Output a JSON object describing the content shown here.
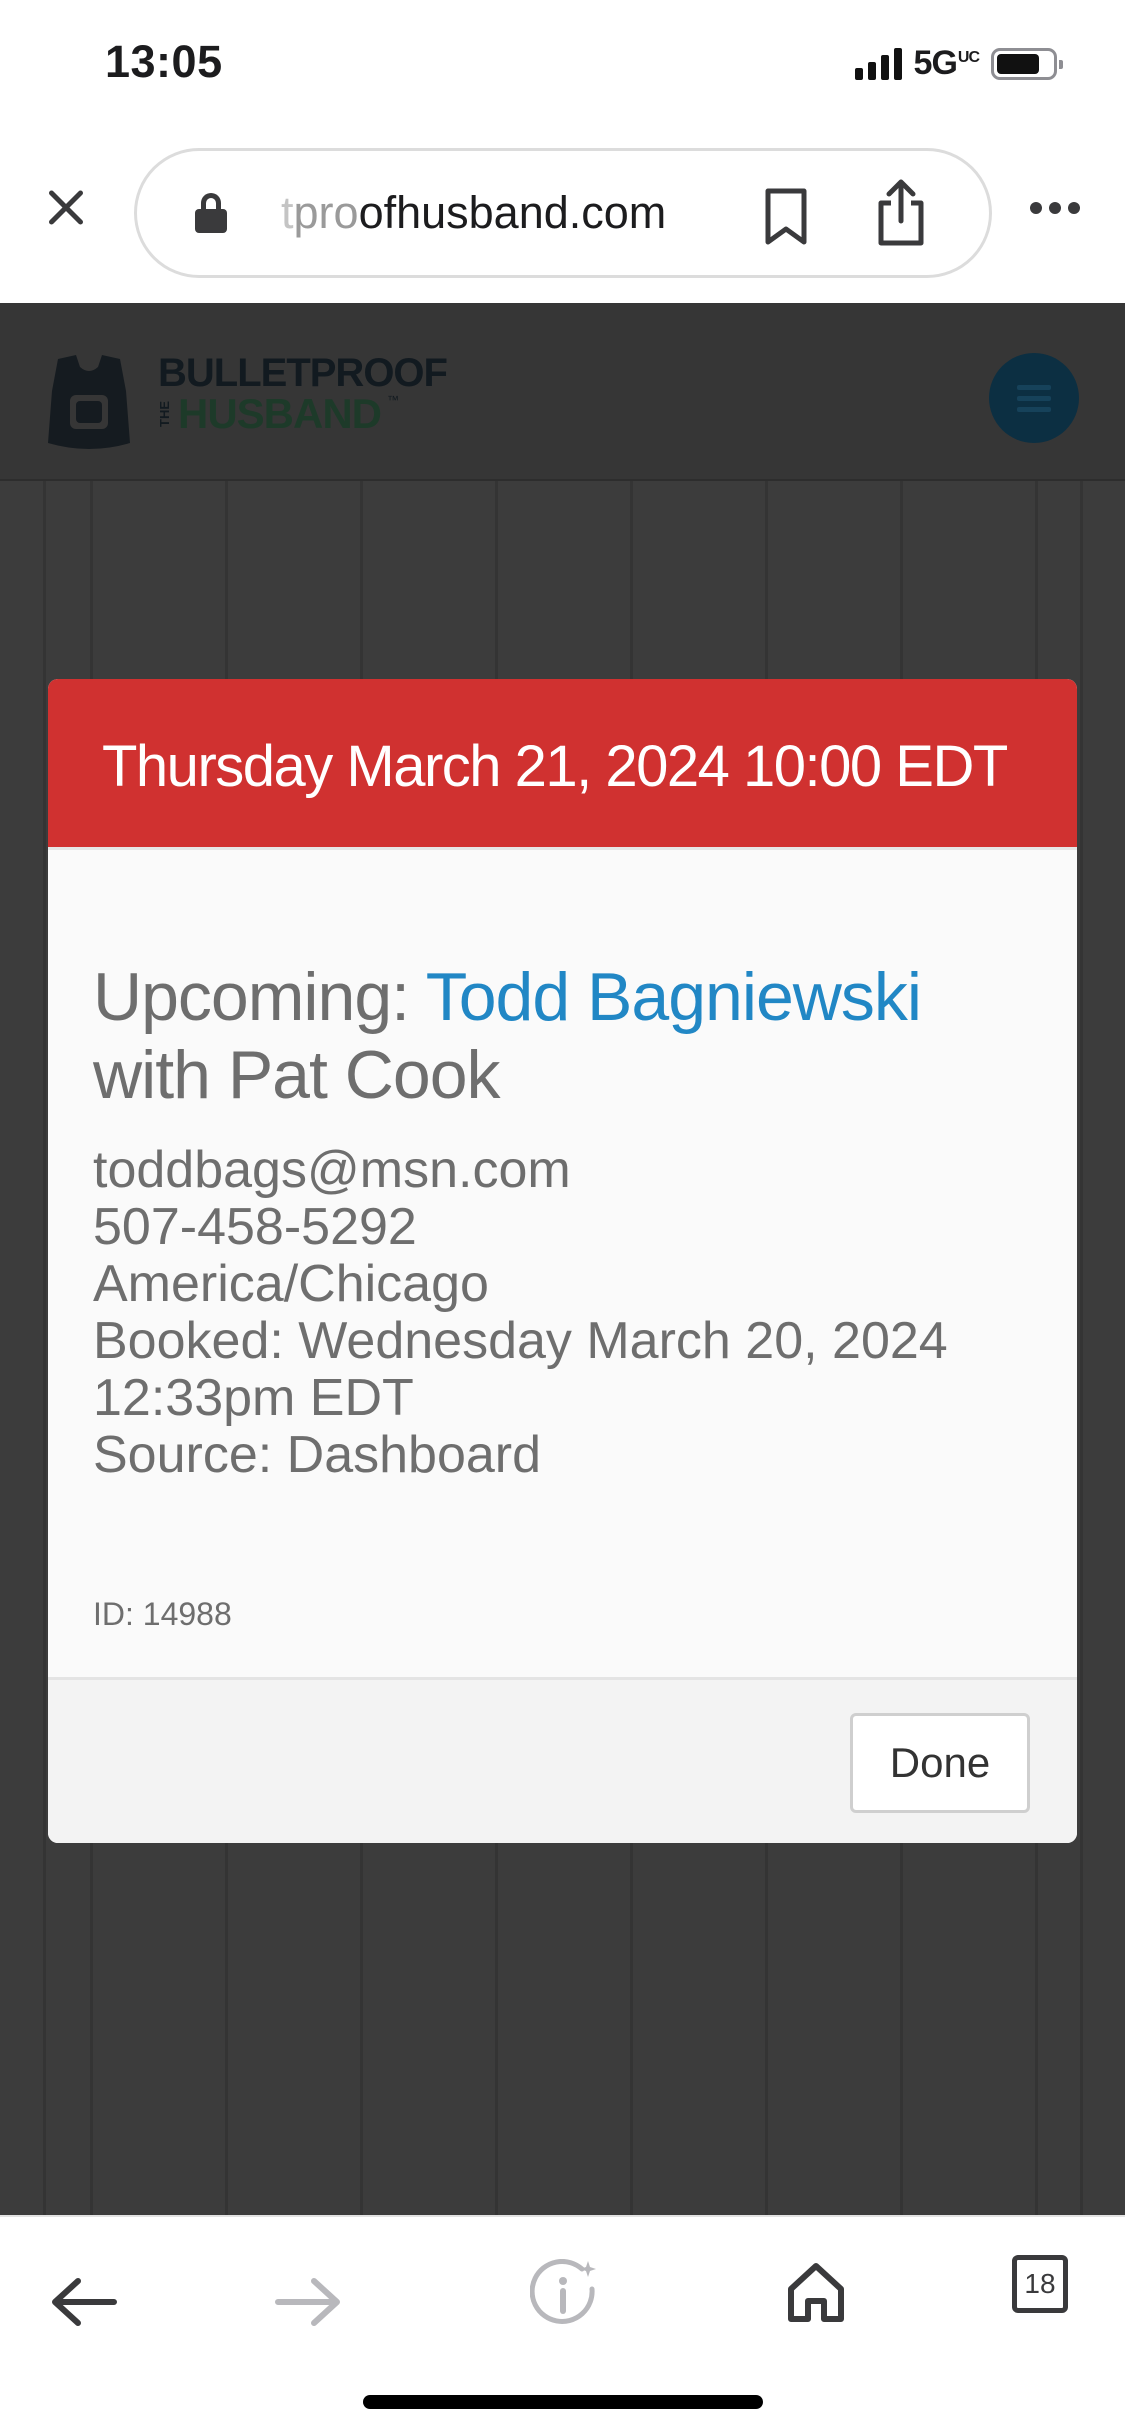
{
  "status_bar": {
    "time": "13:05",
    "network": "5G",
    "network_suffix": "UC"
  },
  "browser": {
    "url_faded": "t",
    "url_prefix_light": "pro",
    "url_main": "ofhusband.com",
    "tab_count": "18"
  },
  "site": {
    "logo_line1": "BULLETPROOF",
    "logo_the": "THE",
    "logo_line2": "HUSBAND",
    "logo_tm": "™"
  },
  "modal": {
    "date_heading": "Thursday March 21, 2024 10:00 EDT",
    "upcoming_label": "Upcoming: ",
    "person_name": "Todd Bagniewski",
    "with_text": "with Pat Cook",
    "email": "toddbags@msn.com",
    "phone": "507-458-5292",
    "timezone": "America/Chicago",
    "booked_line1": "Booked: Wednesday March 20, 2024",
    "booked_line2": "12:33pm EDT",
    "source": "Source: Dashboard",
    "record_id": "ID: 14988",
    "done_label": "Done"
  },
  "colors": {
    "header_red": "#d03130",
    "link_blue": "#2187c5",
    "body_text": "#6e6e6e",
    "overlay_bg": "#3c3c3c"
  }
}
